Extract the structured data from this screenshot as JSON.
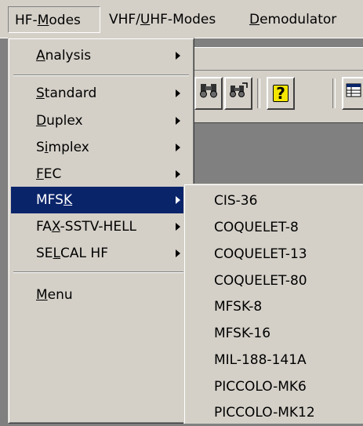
{
  "menubar": {
    "items": [
      {
        "pre": "HF-",
        "u": "M",
        "post": "odes"
      },
      {
        "pre": "VHF/",
        "u": "U",
        "post": "HF-Modes"
      },
      {
        "pre": "",
        "u": "D",
        "post": "emodulator"
      }
    ]
  },
  "hf_menu": {
    "items": [
      {
        "pre": "",
        "u": "A",
        "post": "nalysis"
      },
      {
        "pre": "",
        "u": "S",
        "post": "tandard"
      },
      {
        "pre": "",
        "u": "D",
        "post": "uplex"
      },
      {
        "pre": "S",
        "u": "i",
        "post": "mplex"
      },
      {
        "pre": "",
        "u": "F",
        "post": "EC"
      },
      {
        "pre": "MFS",
        "u": "K",
        "post": ""
      },
      {
        "pre": "FA",
        "u": "X",
        "post": "-SSTV-HELL"
      },
      {
        "pre": "SE",
        "u": "L",
        "post": "CAL HF"
      },
      {
        "pre": "",
        "u": "M",
        "post": "enu"
      }
    ],
    "active": "MFSK"
  },
  "mfsk_menu": {
    "items": [
      "CIS-36",
      "COQUELET-8",
      "COQUELET-13",
      "COQUELET-80",
      "MFSK-8",
      "MFSK-16",
      "MIL-188-141A",
      "PICCOLO-MK6",
      "PICCOLO-MK12"
    ]
  },
  "toolbar": {
    "icons": [
      "binoculars-icon",
      "binoculars-refresh-icon",
      "help-icon",
      "table-icon"
    ],
    "help_glyph": "?"
  },
  "colors": {
    "menu_bg": "#d4d0c8",
    "highlight": "#0a246a",
    "desktop": "#808080"
  }
}
